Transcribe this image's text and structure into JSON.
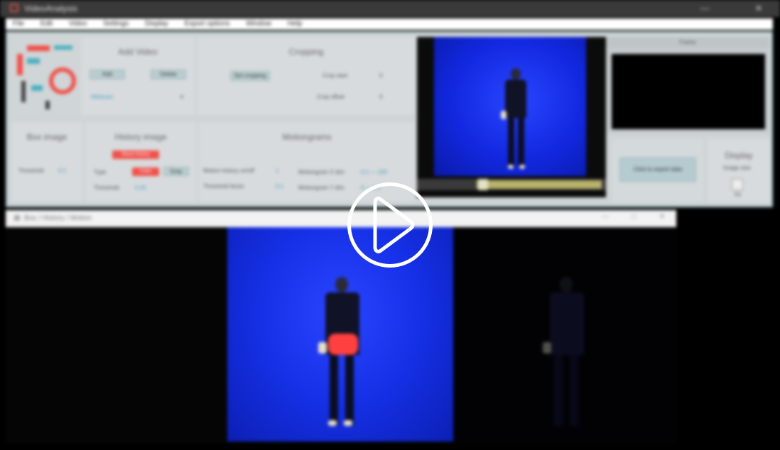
{
  "window": {
    "title": "VideoAnalysis",
    "controls": [
      "—",
      "✕"
    ]
  },
  "menu": [
    "File",
    "Edit",
    "Video",
    "Settings",
    "Display",
    "Export options",
    "Window",
    "Help"
  ],
  "sections": {
    "add_video": {
      "title": "Add Video",
      "buttons": [
        "Add",
        "Delete"
      ],
      "dropdown_value": "Webcam"
    },
    "cropping": {
      "title": "Cropping",
      "button": "Set cropping",
      "fields": [
        {
          "label": "Crop start",
          "value": "0"
        },
        {
          "label": "Crop offset",
          "value": "0"
        }
      ]
    },
    "box_image": {
      "title": "Box image",
      "threshold_label": "Threshold",
      "threshold_value": "0.1"
    },
    "history_image": {
      "title": "History image",
      "top_button": "Show history",
      "type_label": "Type",
      "type_options": [
        "Color",
        "Gray"
      ],
      "threshold_label": "Threshold",
      "threshold_value": "0.25"
    },
    "motiongrams": {
      "title": "Motiongrams",
      "rows": [
        {
          "label": "Motion history on/off",
          "value": "1"
        },
        {
          "label": "Threshold factor",
          "value": "0.1"
        }
      ],
      "rows2": [
        {
          "label": "Motiongram X dim",
          "value": "0.1 — 100"
        },
        {
          "label": "Motiongram Y dim",
          "value": "0 — 0.1"
        }
      ]
    },
    "frame": {
      "title": "Frame"
    },
    "export": {
      "button": "Click to export data"
    },
    "display": {
      "title": "Display",
      "label": "Image size",
      "value": "Fit"
    }
  },
  "sub_window": {
    "title": "Box / History / Motion",
    "controls": [
      "—",
      "□",
      "✕"
    ]
  },
  "player": {
    "state": "paused",
    "overlay": "play"
  }
}
